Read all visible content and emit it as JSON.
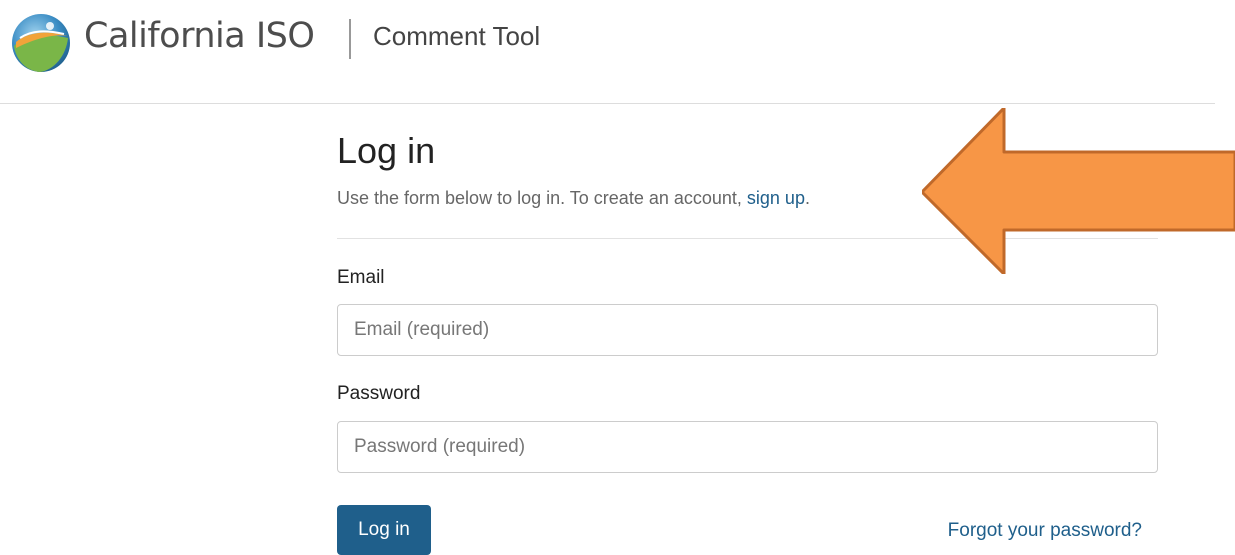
{
  "header": {
    "brand_name": "California ISO",
    "app_title": "Comment Tool",
    "logo_icon": "california-iso-logo"
  },
  "login": {
    "title": "Log in",
    "intro_text": "Use the form below to log in. To create an account, ",
    "signup_link": "sign up",
    "intro_end": ".",
    "email_label": "Email",
    "email_placeholder": "Email (required)",
    "email_value": "",
    "password_label": "Password",
    "password_placeholder": "Password (required)",
    "password_value": "",
    "submit_label": "Log in",
    "forgot_link": "Forgot your password?"
  },
  "annotation": {
    "callout_icon": "arrow-left-icon",
    "callout_color": "#f79646",
    "callout_border": "#c0692a"
  },
  "colors": {
    "link": "#1f5f8b",
    "button": "#1f5f8b"
  }
}
